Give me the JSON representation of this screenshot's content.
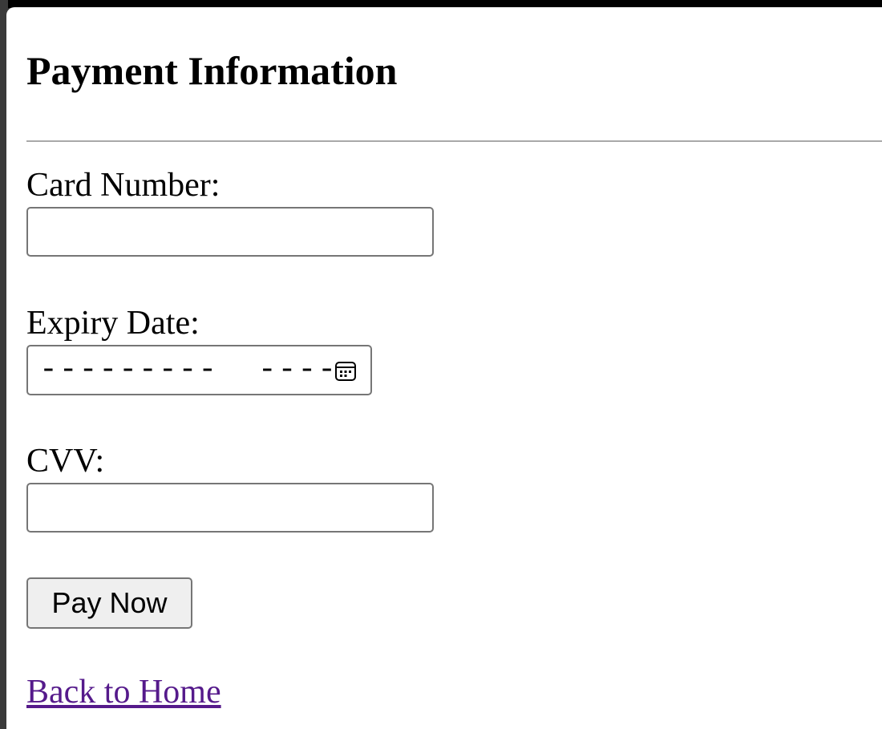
{
  "form": {
    "title": "Payment Information",
    "card_number": {
      "label": "Card Number:",
      "value": ""
    },
    "expiry_date": {
      "label": "Expiry Date:",
      "mask": "---------  ----",
      "icon": "calendar-icon"
    },
    "cvv": {
      "label": "CVV:",
      "value": ""
    },
    "submit_label": "Pay Now"
  },
  "footer": {
    "back_link_label": "Back to Home"
  },
  "colors": {
    "link_visited": "#551a8b",
    "button_background": "#efefef",
    "input_border": "#767676",
    "divider": "#a9a9a9"
  }
}
